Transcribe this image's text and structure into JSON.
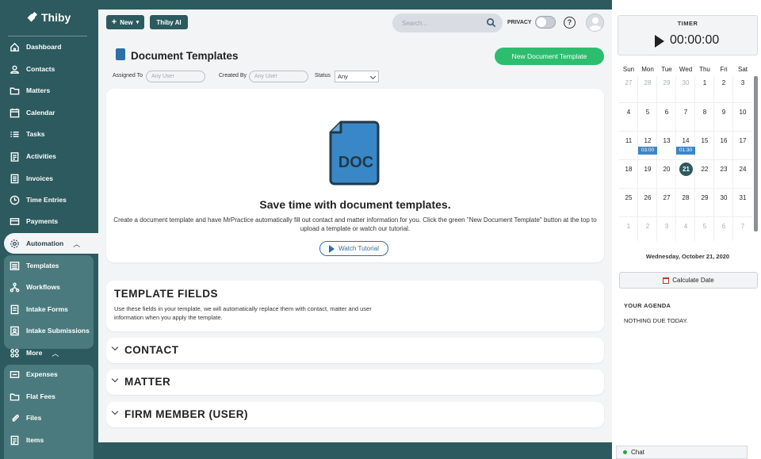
{
  "brand": {
    "name": "Thiby"
  },
  "sidebar": {
    "items": [
      {
        "label": "Dashboard",
        "icon": "home-icon"
      },
      {
        "label": "Contacts",
        "icon": "user-icon"
      },
      {
        "label": "Matters",
        "icon": "folder-icon"
      },
      {
        "label": "Calendar",
        "icon": "calendar-icon"
      },
      {
        "label": "Tasks",
        "icon": "list-icon"
      },
      {
        "label": "Activities",
        "icon": "clipboard-icon"
      },
      {
        "label": "Invoices",
        "icon": "invoice-icon"
      },
      {
        "label": "Time Entries",
        "icon": "clock-icon"
      },
      {
        "label": "Payments",
        "icon": "card-icon"
      }
    ],
    "automation": {
      "label": "Automation",
      "icon": "gear-icon"
    },
    "automation_sub": [
      {
        "label": "Templates",
        "icon": "template-icon"
      },
      {
        "label": "Workflows",
        "icon": "workflow-icon"
      },
      {
        "label": "Intake Forms",
        "icon": "form-icon"
      },
      {
        "label": "Intake Submissions",
        "icon": "submission-icon"
      }
    ],
    "more": {
      "label": "More",
      "icon": "grid-icon"
    },
    "more_sub": [
      {
        "label": "Expenses",
        "icon": "expense-icon"
      },
      {
        "label": "Flat Fees",
        "icon": "flatfee-icon"
      },
      {
        "label": "Files",
        "icon": "paperclip-icon"
      },
      {
        "label": "Items",
        "icon": "items-icon"
      }
    ]
  },
  "toolbar": {
    "new_label": "New",
    "ai_label": "Thiby AI",
    "search_placeholder": "Search...",
    "privacy_label": "PRIVACY",
    "help_label": "?"
  },
  "page": {
    "title": "Document Templates",
    "new_template_label": "New Document Template",
    "filters": {
      "assigned_label": "Assigned To",
      "assigned_placeholder": "Any User",
      "created_label": "Created By",
      "created_placeholder": "Any User",
      "status_label": "Status",
      "status_value": "Any"
    },
    "hero": {
      "icon_text": "DOC",
      "title": "Save time with document templates.",
      "desc": "Create a document template and have MrPractice automatically fill out contact and matter information for you. Click the green \"New Document Template\" button at the top to upload a template or watch our tutorial.",
      "button": "Watch Tutorial"
    },
    "template_fields": {
      "title": "TEMPLATE FIELDS",
      "desc": "Use these fields in your template, we will automatically replace them with contact, matter and user information when you apply the template."
    },
    "sections": [
      "CONTACT",
      "MATTER",
      "FIRM MEMBER (USER)"
    ]
  },
  "timer": {
    "label": "TIMER",
    "time": "00:00:00"
  },
  "calendar": {
    "weekdays": [
      "Sun",
      "Mon",
      "Tue",
      "Wed",
      "Thu",
      "Fri",
      "Sat"
    ],
    "weeks": [
      [
        "27",
        "28",
        "29",
        "30",
        "1",
        "2",
        "3"
      ],
      [
        "4",
        "5",
        "6",
        "7",
        "8",
        "9",
        "10"
      ],
      [
        "11",
        "12",
        "13",
        "14",
        "15",
        "16",
        "17"
      ],
      [
        "18",
        "19",
        "20",
        "21",
        "22",
        "23",
        "24"
      ],
      [
        "25",
        "26",
        "27",
        "28",
        "29",
        "30",
        "31"
      ],
      [
        "1",
        "2",
        "3",
        "4",
        "5",
        "6",
        "7"
      ]
    ],
    "events": [
      {
        "week": 2,
        "day": 1,
        "label": "03:00"
      },
      {
        "week": 2,
        "day": 3,
        "label": "01:30"
      }
    ],
    "selected_date": "Wednesday, October 21, 2020",
    "calc_label": "Calculate Date"
  },
  "agenda": {
    "title": "YOUR AGENDA",
    "empty": "NOTHING DUE TODAY."
  },
  "chat": {
    "label": "Chat"
  }
}
